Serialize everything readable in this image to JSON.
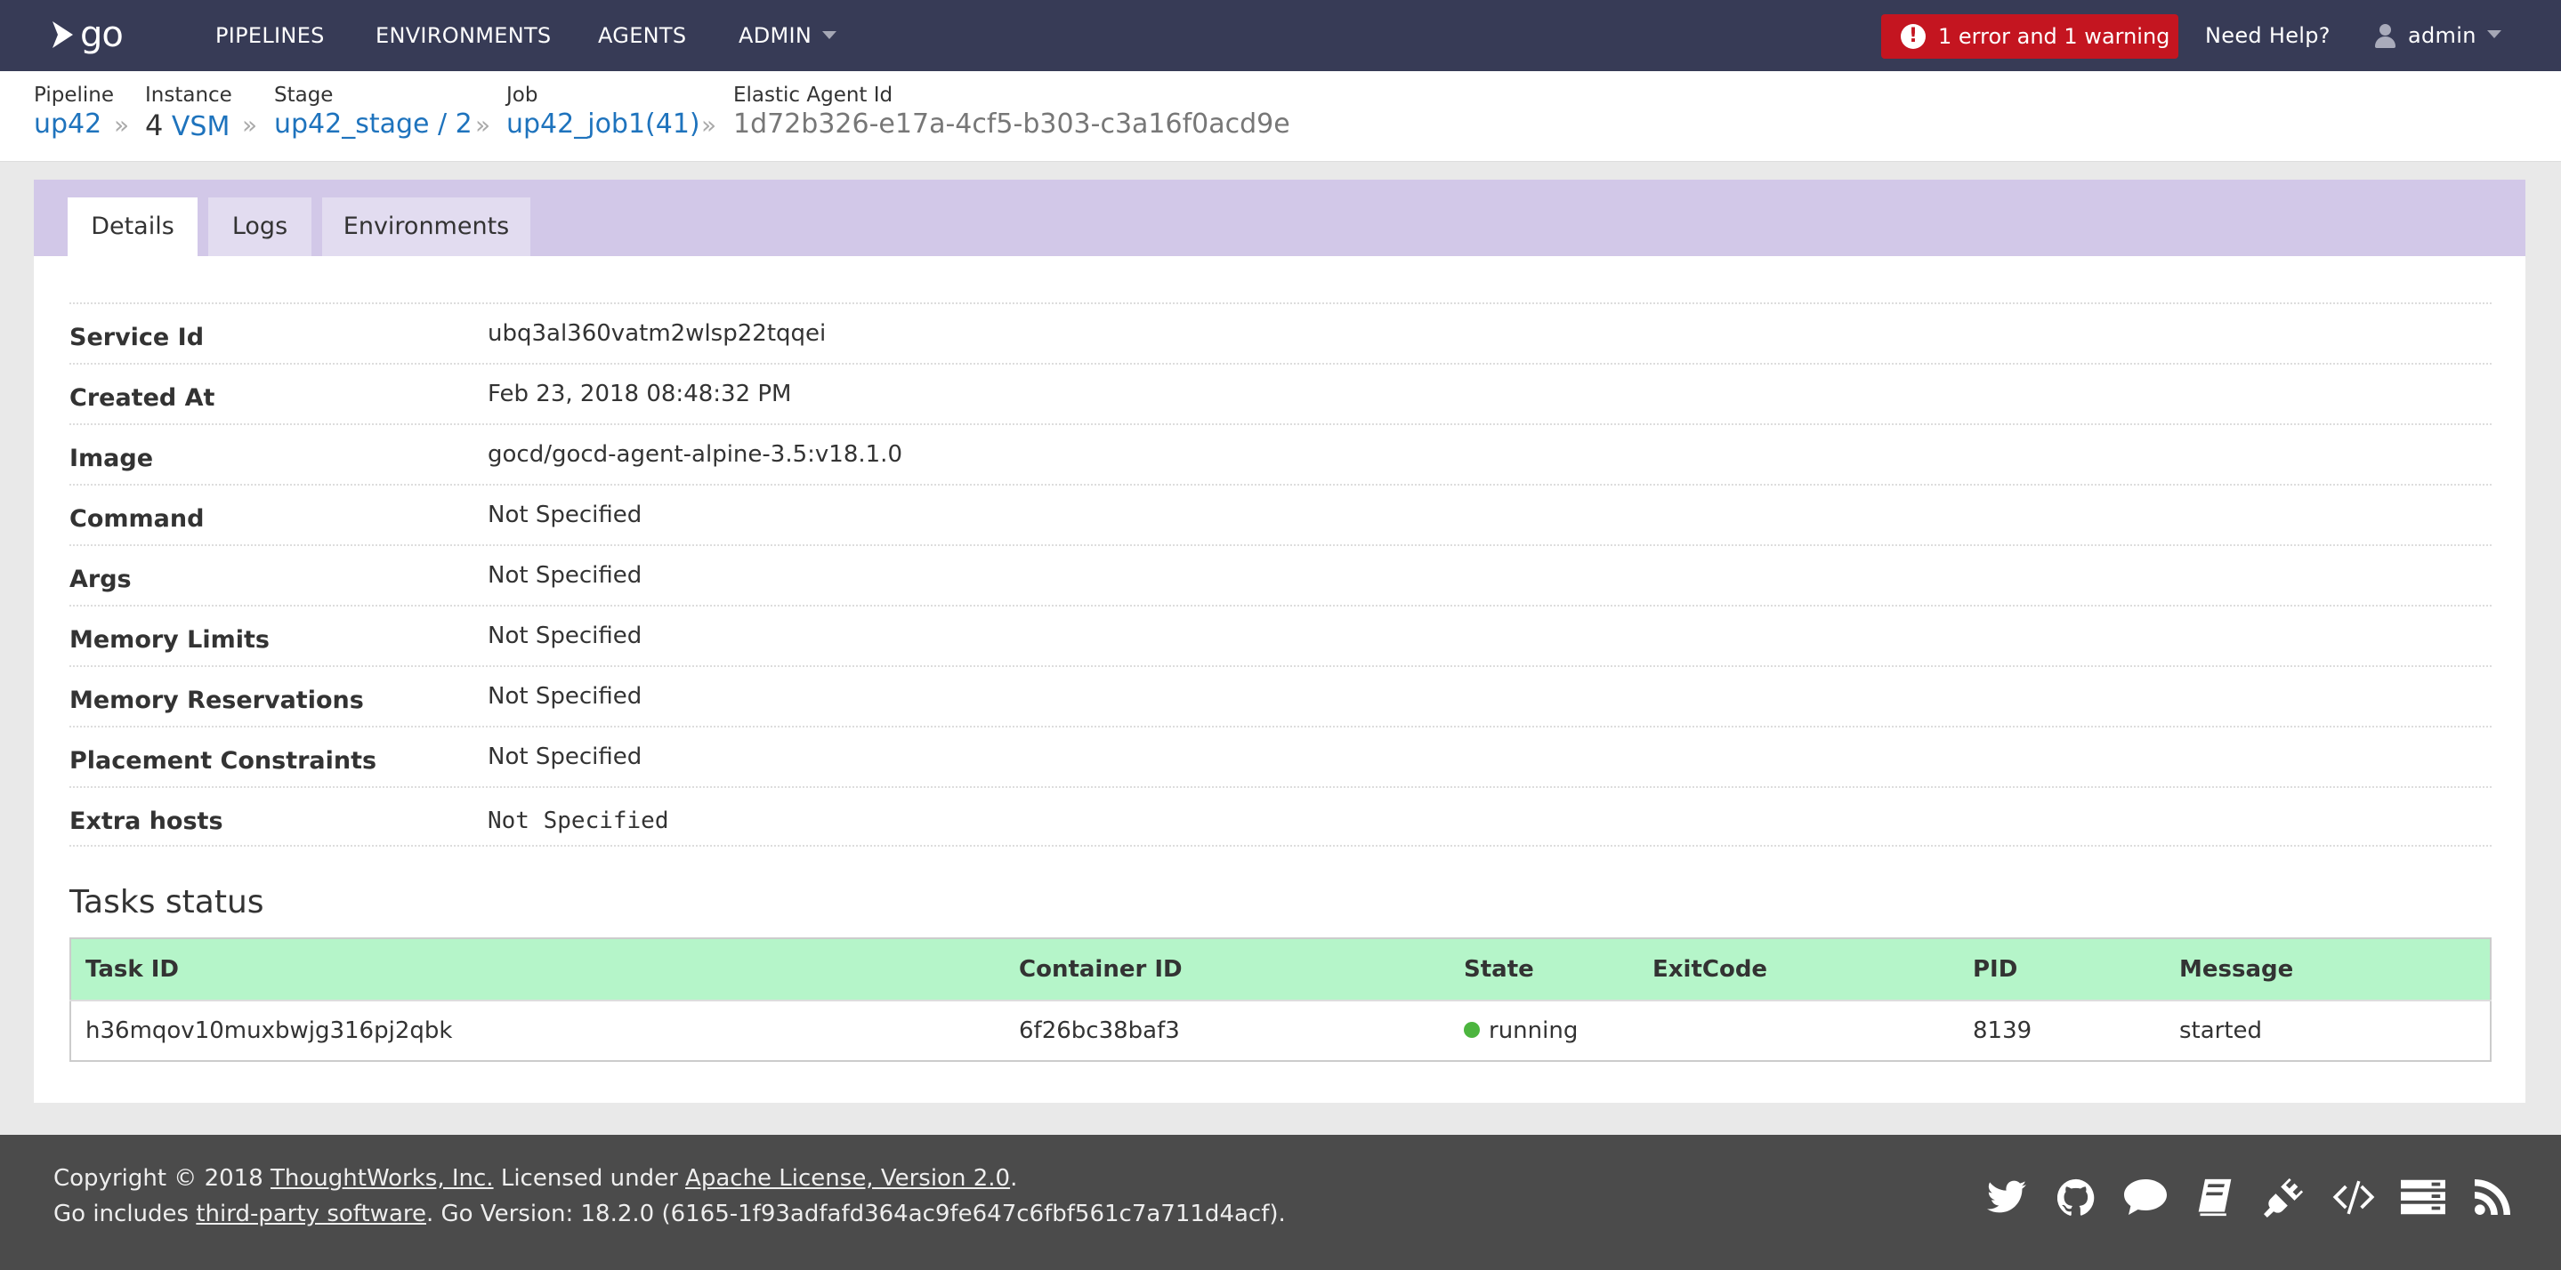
{
  "nav": {
    "logo_text": "go",
    "items": [
      "PIPELINES",
      "ENVIRONMENTS",
      "AGENTS",
      "ADMIN"
    ],
    "error_badge": "1 error and 1 warning",
    "help": "Need Help?",
    "user": "admin"
  },
  "breadcrumb": {
    "pipeline_label": "Pipeline",
    "pipeline": "up42",
    "instance_label": "Instance",
    "instance_num": "4",
    "instance_link": "VSM",
    "stage_label": "Stage",
    "stage": "up42_stage / 2",
    "job_label": "Job",
    "job": "up42_job1(41)",
    "agent_label": "Elastic Agent Id",
    "agent_id": "1d72b326-e17a-4cf5-b303-c3a16f0acd9e",
    "separator": "»"
  },
  "tabs": [
    "Details",
    "Logs",
    "Environments"
  ],
  "active_tab": "Details",
  "details": [
    {
      "key": "Service Id",
      "value": "ubq3al360vatm2wlsp22tqqei"
    },
    {
      "key": "Created At",
      "value": "Feb 23, 2018 08:48:32 PM"
    },
    {
      "key": "Image",
      "value": "gocd/gocd-agent-alpine-3.5:v18.1.0"
    },
    {
      "key": "Command",
      "value": "Not Specified"
    },
    {
      "key": "Args",
      "value": "Not Specified"
    },
    {
      "key": "Memory Limits",
      "value": "Not Specified"
    },
    {
      "key": "Memory Reservations",
      "value": "Not Specified"
    },
    {
      "key": "Placement Constraints",
      "value": "Not Specified"
    },
    {
      "key": "Extra hosts",
      "value": "Not Specified"
    }
  ],
  "tasks": {
    "title": "Tasks status",
    "columns": [
      "Task ID",
      "Container ID",
      "State",
      "ExitCode",
      "PID",
      "Message"
    ],
    "rows": [
      {
        "task_id": "h36mqov10muxbwjg316pj2qbk",
        "container_id": "6f26bc38baf3",
        "state": "running",
        "exit_code": "",
        "pid": "8139",
        "message": "started"
      }
    ],
    "state_color": "#4cb53f"
  },
  "footer": {
    "copyright_prefix": "Copyright © 2018 ",
    "company": "ThoughtWorks, Inc.",
    "licensed": " Licensed under ",
    "license": "Apache License, Version 2.0",
    "period": ".",
    "includes_prefix": "Go includes ",
    "third_party": "third-party software",
    "version_text": ". Go Version: 18.2.0 (6165-1f93adfafd364ac9fe647c6fbf561c7a711d4acf).",
    "icons": [
      "twitter-icon",
      "github-icon",
      "chat-icon",
      "documentation-icon",
      "plugins-icon",
      "api-icon",
      "server-details-icon",
      "rss-icon"
    ]
  },
  "colors": {
    "nav_bg": "#373b56",
    "error": "#c41520",
    "link": "#1e73bd",
    "tab_bar": "#d2c8e8",
    "table_header": "#b5f5c9",
    "footer_bg": "#4b4b4b"
  }
}
